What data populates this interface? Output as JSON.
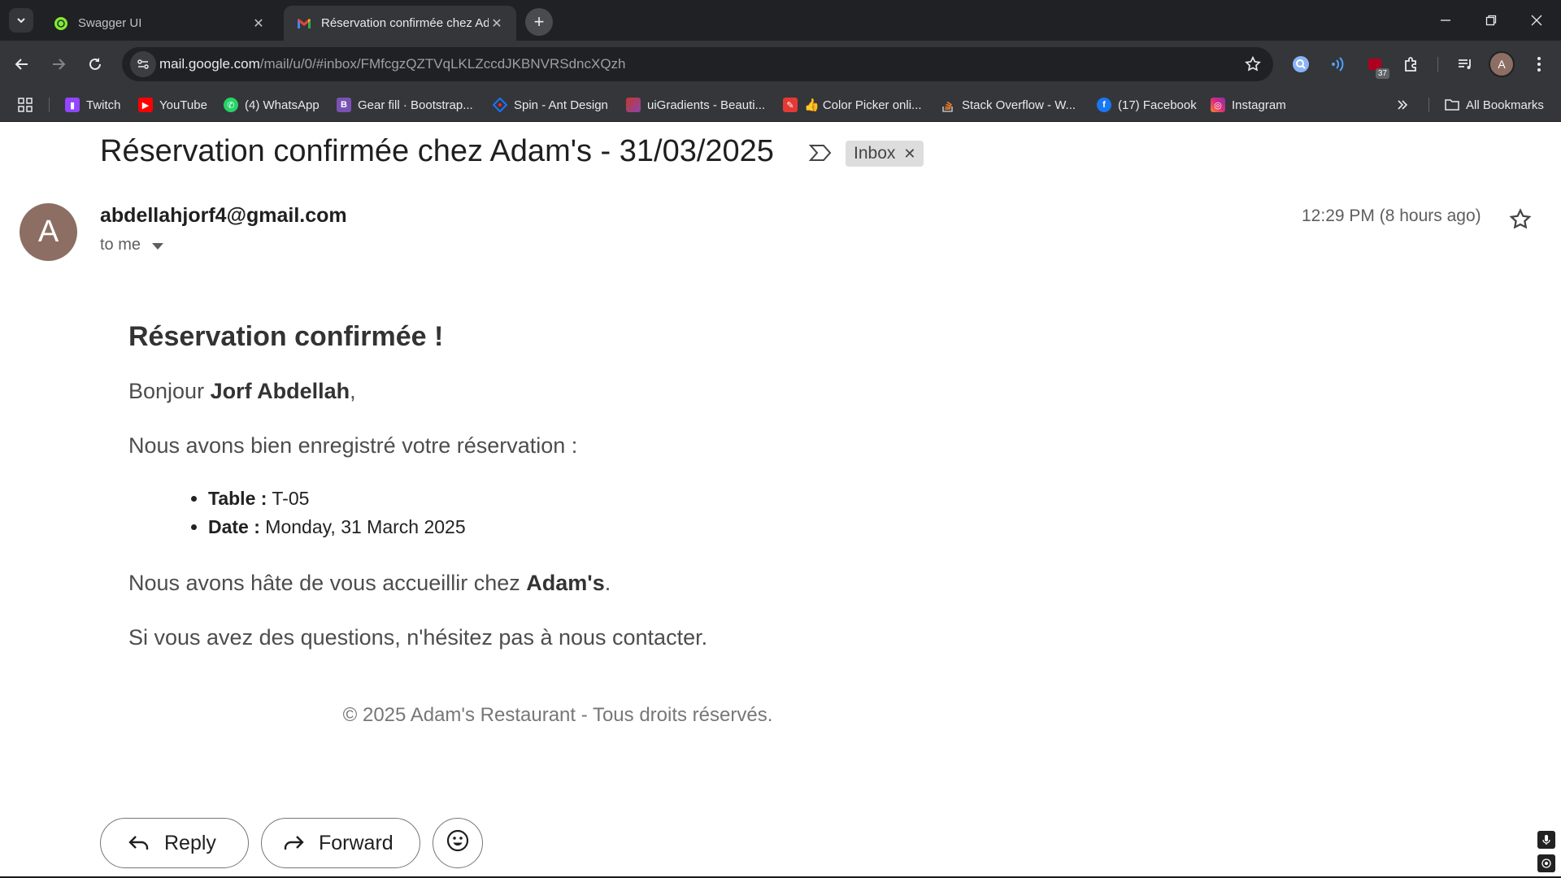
{
  "browser": {
    "tabs": [
      {
        "title": "Swagger UI",
        "favicon": "swagger-icon"
      },
      {
        "title": "Réservation confirmée chez Adam's",
        "favicon": "gmail-icon"
      }
    ],
    "url_host": "mail.google.com",
    "url_path": "/mail/u/0/#inbox/FMfcgzQZTVqLKLZccdJKBNVRSdncXQzh",
    "extension_badge": "37",
    "profile_initial": "A",
    "bookmarks": [
      {
        "label": "Twitch",
        "color": "#9146ff"
      },
      {
        "label": "YouTube",
        "color": "#ff0000"
      },
      {
        "label": "(4) WhatsApp",
        "color": "#25d366"
      },
      {
        "label": "Gear fill · Bootstrap...",
        "color": "#7952b3"
      },
      {
        "label": "Spin - Ant Design",
        "color": "#1677ff"
      },
      {
        "label": "uiGradients - Beauti...",
        "color": "#c0392b"
      },
      {
        "label": "👍 Color Picker onli...",
        "color": "#e53935"
      },
      {
        "label": "Stack Overflow - W...",
        "color": "#f48024"
      },
      {
        "label": "(17) Facebook",
        "color": "#1877f2"
      },
      {
        "label": "Instagram",
        "color": "#e1306c"
      }
    ],
    "all_bookmarks": "All Bookmarks"
  },
  "email": {
    "subject": "Réservation confirmée chez Adam's - 31/03/2025",
    "label": "Inbox",
    "sender_initial": "A",
    "sender": "abdellahjorf4@gmail.com",
    "recipient": "to me",
    "time": "12:29 PM (8 hours ago)",
    "body": {
      "heading": "Réservation confirmée !",
      "greeting_prefix": "Bonjour ",
      "greeting_name": "Jorf Abdellah",
      "greeting_suffix": ",",
      "intro": "Nous avons bien enregistré votre réservation :",
      "table_label": "Table :",
      "table_value": " T-05",
      "date_label": "Date :",
      "date_value": " Monday, 31 March 2025",
      "closing_prefix": "Nous avons hâte de vous accueillir chez ",
      "closing_name": "Adam's",
      "closing_suffix": ".",
      "contact": "Si vous avez des questions, n'hésitez pas à nous contacter.",
      "footer": "© 2025 Adam's Restaurant - Tous droits réservés."
    },
    "actions": {
      "reply": "Reply",
      "forward": "Forward"
    }
  }
}
